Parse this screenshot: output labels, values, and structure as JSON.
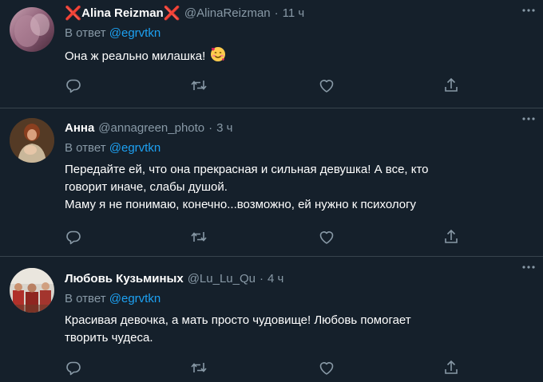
{
  "colors": {
    "background": "#15202b",
    "divider": "#38444d",
    "secondary_text": "#8899a6",
    "link": "#1da1f2",
    "primary_text": "#ffffff",
    "x_mark": "#e0245e"
  },
  "tweets": [
    {
      "name": "Alina Reizman",
      "name_prefix": "❌",
      "name_suffix": "❌",
      "handle": "@AlinaReizman",
      "dot": "·",
      "time": "11 ч",
      "reply_label": "В ответ ",
      "reply_mention": "@egrvtkn",
      "text": "Она ж реально милашка! ",
      "emoji": "smiling-face-with-hearts-emoji"
    },
    {
      "name": "Анна",
      "handle": "@annagreen_photo",
      "dot": "·",
      "time": "3 ч",
      "reply_label": "В ответ ",
      "reply_mention": "@egrvtkn",
      "text": "Передайте ей, что она прекрасная и сильная девушка! А все, кто\nговорит иначе, слабы душой.\nМаму я не понимаю, конечно...возможно, ей нужно к психологу"
    },
    {
      "name": "Любовь Кузьминых",
      "handle": "@Lu_Lu_Qu",
      "dot": "·",
      "time": "4 ч",
      "reply_label": "В ответ ",
      "reply_mention": "@egrvtkn",
      "text": "Красивая девочка, а мать просто чудовище! Любовь помогает\nтворить чудеса."
    }
  ],
  "icons": {
    "more": "more-horizontal-icon",
    "reply": "reply-bubble-icon",
    "retweet": "retweet-icon",
    "like": "heart-icon",
    "share": "share-icon"
  }
}
